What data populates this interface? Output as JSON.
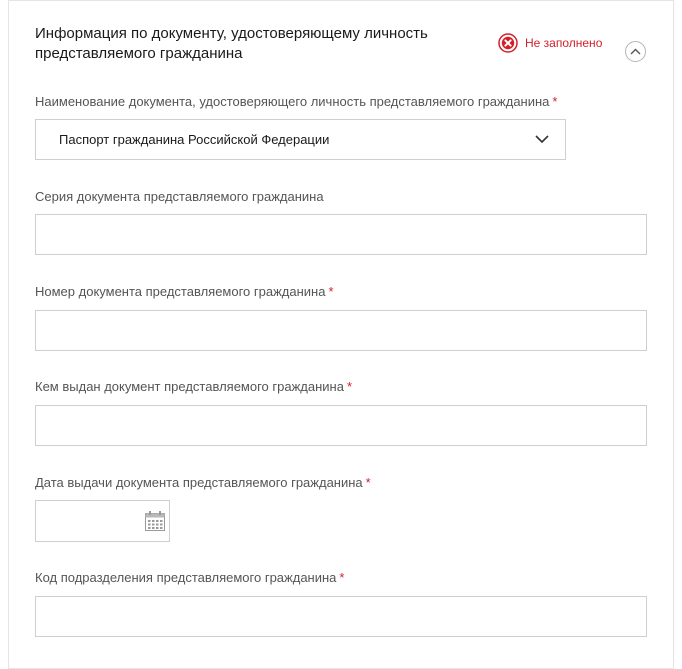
{
  "section": {
    "title": "Информация по документу, удостоверяющему личность представляемого гражданина",
    "status_text": "Не заполнено",
    "status_color": "#d31f2a",
    "status_icon": "error-x-circle-icon",
    "collapse_icon": "chevron-up-icon"
  },
  "fields": {
    "doc_type": {
      "label": "Наименование документа, удостоверяющего личность представляемого гражданина",
      "required_mark": "*",
      "value": "Паспорт гражданина Российской Федерации"
    },
    "series": {
      "label": "Серия документа представляемого гражданина",
      "value": ""
    },
    "number": {
      "label": "Номер документа представляемого гражданина",
      "required_mark": "*",
      "value": ""
    },
    "issued_by": {
      "label": "Кем выдан документ представляемого гражданина",
      "required_mark": "*",
      "value": ""
    },
    "issue_date": {
      "label": "Дата выдачи документа представляемого гражданина",
      "required_mark": "*",
      "value": "",
      "icon": "calendar-icon"
    },
    "division_code": {
      "label": "Код подразделения представляемого гражданина",
      "required_mark": "*",
      "value": ""
    }
  }
}
